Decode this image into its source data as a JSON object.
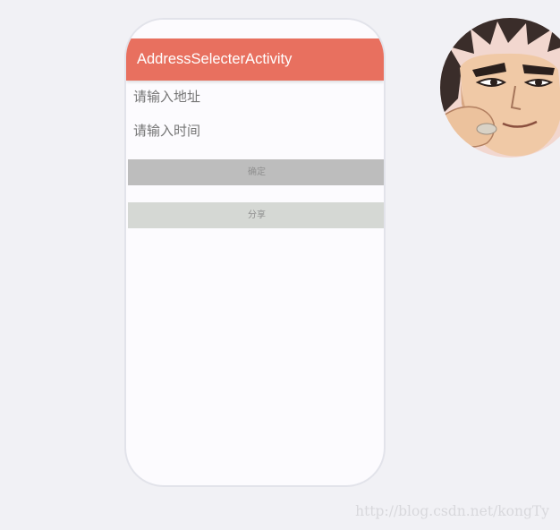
{
  "appbar": {
    "title": "AddressSelecterActivity",
    "color": "#e8705f"
  },
  "form": {
    "address_placeholder": "请输入地址",
    "time_placeholder": "请输入时间"
  },
  "buttons": {
    "confirm_label": "确定",
    "share_label": "分享"
  },
  "avatar": {
    "icon": "cartoon-warrior-avatar"
  },
  "watermark": {
    "text": "http://blog.csdn.net/kongTy"
  }
}
